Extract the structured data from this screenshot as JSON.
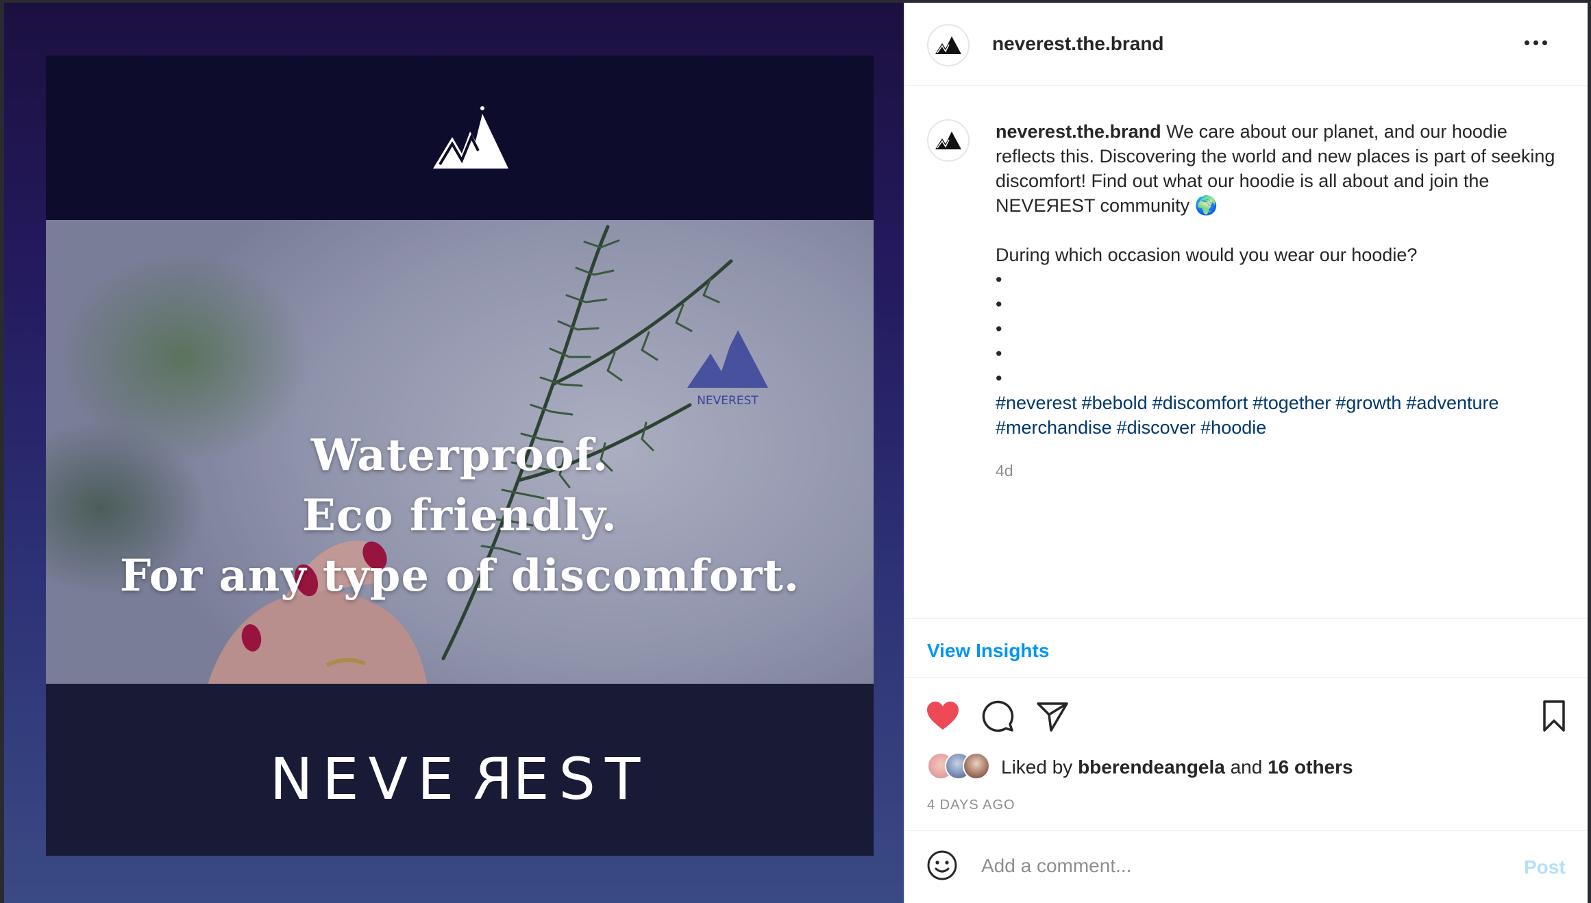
{
  "post_image": {
    "headline": [
      "Waterproof.",
      "Eco friendly.",
      "For any type of discomfort."
    ],
    "brand_wordmark": [
      "NEVE",
      "R",
      "EST"
    ],
    "emblem_text": "NEVEREST"
  },
  "header": {
    "username": "neverest.the.brand",
    "more_icon": "more-horizontal-icon"
  },
  "caption": {
    "username": "neverest.the.brand",
    "text": "We care about our planet, and our hoodie reflects this. Discovering the world and new places is part of seeking discomfort! Find out what our hoodie is all about and join the NEVEЯEST community 🌍",
    "question": "During which occasion would you wear our hoodie?",
    "dots": [
      "•",
      "•",
      "•",
      "•",
      "•"
    ],
    "hashtags": [
      "#neverest",
      "#bebold",
      "#discomfort",
      "#together",
      "#growth",
      "#adventure",
      "#merchandise",
      "#discover",
      "#hoodie"
    ],
    "age": "4d"
  },
  "insights": {
    "label": "View Insights"
  },
  "actions": {
    "like_icon": "heart-filled-icon",
    "comment_icon": "comment-icon",
    "share_icon": "paper-plane-icon",
    "save_icon": "bookmark-icon",
    "like_color": "#ed4956"
  },
  "likes": {
    "prefix": "Liked by",
    "user": "bberendeangela",
    "conjunction": "and",
    "others": "16 others"
  },
  "date": "4 DAYS AGO",
  "comment": {
    "placeholder": "Add a comment...",
    "post_label": "Post",
    "emoji_icon": "smiley-icon"
  },
  "colors": {
    "link_blue": "#0095f6",
    "hashtag_blue": "#00376b",
    "post_disabled": "#b2dffc"
  }
}
